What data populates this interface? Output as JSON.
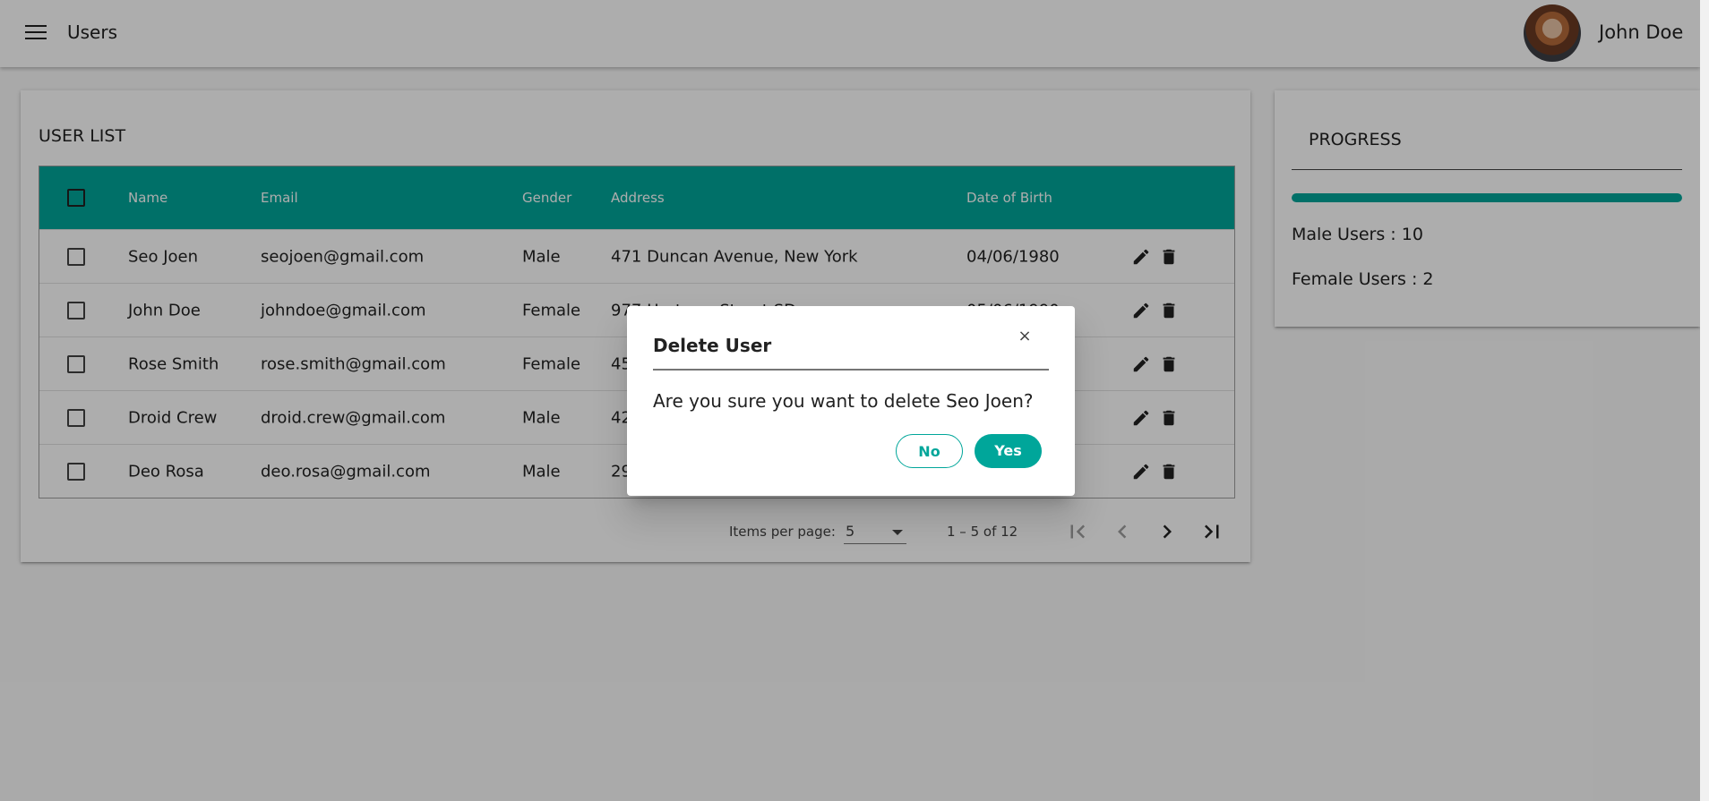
{
  "header": {
    "title": "Users",
    "user_name": "John Doe",
    "menu_icon": "menu-icon",
    "avatar_icon": "avatar"
  },
  "user_list": {
    "title": "USER LIST",
    "columns": [
      "Name",
      "Email",
      "Gender",
      "Address",
      "Date of Birth"
    ],
    "rows": [
      {
        "name": "Seo Joen",
        "email": "seojoen@gmail.com",
        "gender": "Male",
        "address": "471 Duncan Avenue, New York",
        "dob": "04/06/1980"
      },
      {
        "name": "John Doe",
        "email": "johndoe@gmail.com",
        "gender": "Female",
        "address": "977 Hartway Street SD",
        "dob": "05/06/1990"
      },
      {
        "name": "Rose Smith",
        "email": "rose.smith@gmail.com",
        "gender": "Female",
        "address": "45",
        "dob": ""
      },
      {
        "name": "Droid Crew",
        "email": "droid.crew@gmail.com",
        "gender": "Male",
        "address": "42",
        "dob": ""
      },
      {
        "name": "Deo Rosa",
        "email": "deo.rosa@gmail.com",
        "gender": "Male",
        "address": "29",
        "dob": ""
      }
    ],
    "paginator": {
      "items_per_page_label": "Items per page:",
      "page_size": "5",
      "range": "1 – 5 of 12"
    }
  },
  "progress": {
    "title": "PROGRESS",
    "fill_fraction": 1.0,
    "male_label": "Male Users : 10",
    "female_label": "Female Users : 2"
  },
  "dialog": {
    "title": "Delete User",
    "close": "×",
    "message": "Are you sure you want to delete Seo Joen?",
    "no_label": "No",
    "yes_label": "Yes"
  },
  "colors": {
    "accent": "#00a69a"
  }
}
